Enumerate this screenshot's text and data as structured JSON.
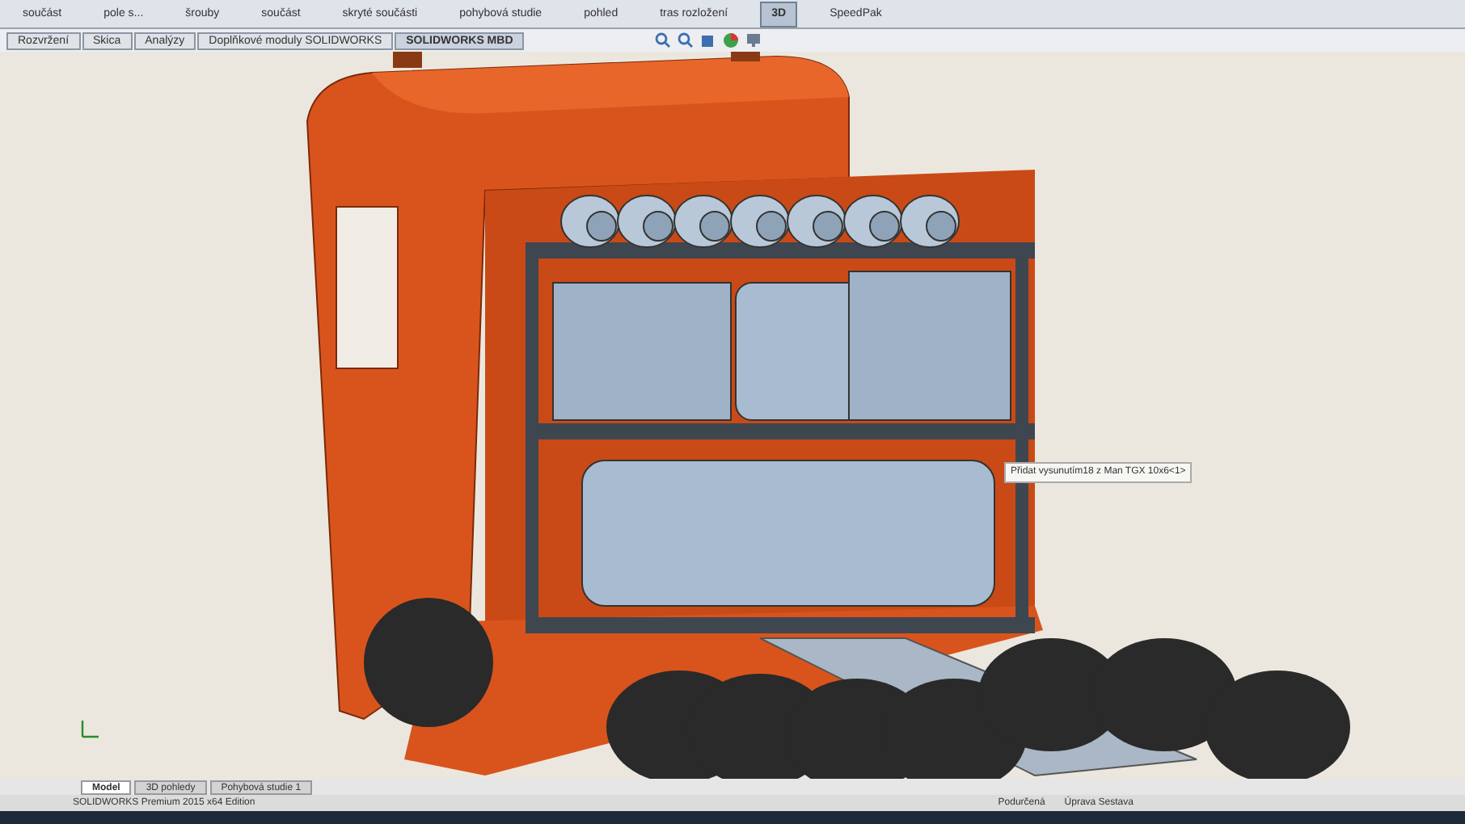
{
  "ribbon": {
    "items": [
      {
        "label": "součást",
        "selected": false
      },
      {
        "label": "pole s...",
        "selected": false
      },
      {
        "label": "šrouby",
        "selected": false
      },
      {
        "label": "součást",
        "selected": false
      },
      {
        "label": "skryté součásti",
        "selected": false
      },
      {
        "label": "pohybová studie",
        "selected": false
      },
      {
        "label": "pohled",
        "selected": false
      },
      {
        "label": "tras rozložení",
        "selected": false
      },
      {
        "label": "3D",
        "selected": true
      },
      {
        "label": "SpeedPak",
        "selected": false
      }
    ]
  },
  "tabs": [
    {
      "label": "Rozvržení",
      "selected": false
    },
    {
      "label": "Skica",
      "selected": false
    },
    {
      "label": "Analýzy",
      "selected": false
    },
    {
      "label": "Doplňkové moduly SOLIDWORKS",
      "selected": false
    },
    {
      "label": "SOLIDWORKS MBD",
      "selected": true
    }
  ],
  "viewport": {
    "tooltip": "Přidat vysunutím18 z Man TGX 10x6<1>"
  },
  "bottom_tabs": [
    {
      "label": "Model",
      "selected": true
    },
    {
      "label": "3D pohledy",
      "selected": false
    },
    {
      "label": "Pohybová studie 1",
      "selected": false
    }
  ],
  "status_bar": {
    "product": "SOLIDWORKS Premium 2015 x64 Edition",
    "items": [
      "Podurčená",
      "Úprava Sestava"
    ]
  }
}
